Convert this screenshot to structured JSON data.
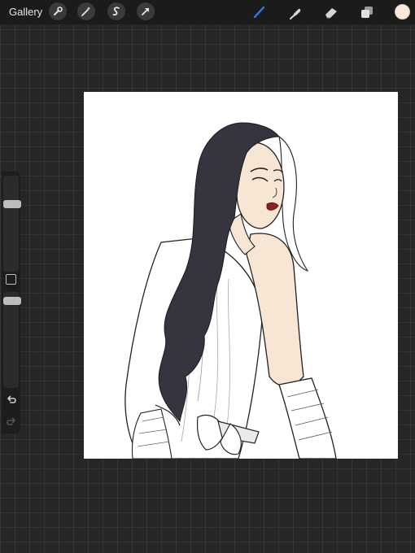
{
  "topbar": {
    "gallery_label": "Gallery",
    "left_tools": [
      {
        "icon": "wrench-icon",
        "name": "actions"
      },
      {
        "icon": "magic-wand-icon",
        "name": "adjustments"
      },
      {
        "icon": "selection-s-icon",
        "name": "selection"
      },
      {
        "icon": "transform-arrow-icon",
        "name": "transform"
      }
    ],
    "right_tools": [
      {
        "icon": "brush-icon",
        "name": "paint",
        "active": true
      },
      {
        "icon": "smudge-icon",
        "name": "smudge"
      },
      {
        "icon": "eraser-icon",
        "name": "erase"
      },
      {
        "icon": "layers-icon",
        "name": "layers"
      }
    ],
    "current_color": "#fbe8d6"
  },
  "sidebar": {
    "brush_size_level": 0.72,
    "brush_opacity_level": 0.94
  },
  "colors": {
    "accent": "#2f7de1",
    "hair": "#34353f",
    "skin": "#f8e6d4",
    "lips": "#8f1f25",
    "background": "#262626"
  }
}
